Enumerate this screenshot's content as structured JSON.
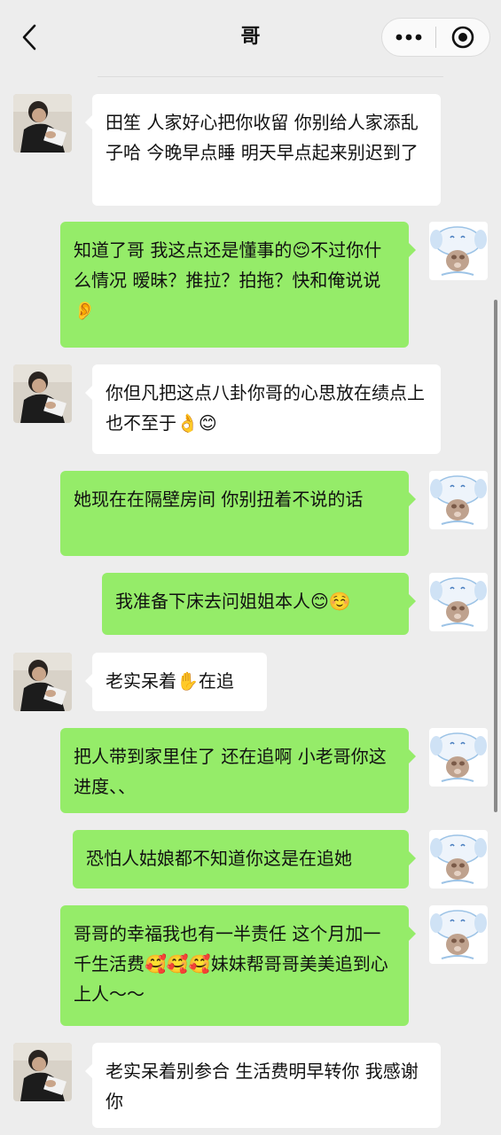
{
  "header": {
    "title": "哥",
    "back_icon": "chevron-left-icon",
    "more_icon": "more-dots-icon",
    "close_icon": "target-close-icon"
  },
  "colors": {
    "background": "#ededed",
    "bubble_self": "#95ec69",
    "bubble_other": "#ffffff"
  },
  "messages": [
    {
      "sender": "other",
      "text": "田笙  人家好心把你收留  你别给人家添乱子哈  今晚早点睡  明天早点起来别迟到了"
    },
    {
      "sender": "self",
      "text": "知道了哥  我这点还是懂事的😌不过你什么情况  暧昧？推拉？拍拖？快和俺说说👂"
    },
    {
      "sender": "other",
      "text": "你但凡把这点八卦你哥的心思放在绩点上  也不至于👌😊"
    },
    {
      "sender": "self",
      "text": "她现在在隔壁房间  你别扭着不说的话"
    },
    {
      "sender": "self",
      "text": "我准备下床去问姐姐本人😊☺️"
    },
    {
      "sender": "other",
      "text": "老实呆着✋在追"
    },
    {
      "sender": "self",
      "text": "把人带到家里住了  还在追啊  小老哥你这进度、、"
    },
    {
      "sender": "self",
      "text": "恐怕人姑娘都不知道你这是在追她"
    },
    {
      "sender": "self",
      "text": "哥哥的幸福我也有一半责任  这个月加一千生活费🥰🥰🥰妹妹帮哥哥美美追到心上人～～"
    },
    {
      "sender": "other",
      "text": "老实呆着别参合  生活费明早转你  我感谢你"
    }
  ]
}
